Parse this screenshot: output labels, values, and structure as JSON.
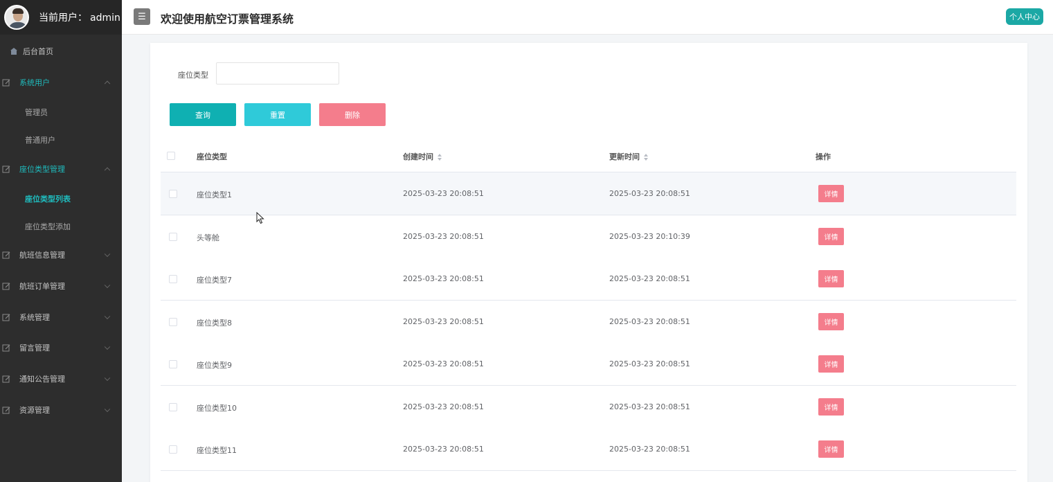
{
  "user": {
    "label": "当前用户：",
    "name": "admin"
  },
  "header": {
    "title": "欢迎使用航空订票管理系统",
    "menu_icon": "☰",
    "personal_center": "个人中心"
  },
  "sidebar": {
    "home": "后台首页",
    "groups": [
      {
        "label": "系统用户",
        "open": true,
        "children": [
          "管理员",
          "普通用户"
        ]
      },
      {
        "label": "座位类型管理",
        "open": true,
        "children": [
          "座位类型列表",
          "座位类型添加"
        ],
        "active_child": "座位类型列表"
      },
      {
        "label": "航班信息管理",
        "open": false
      },
      {
        "label": "航班订单管理",
        "open": false
      },
      {
        "label": "系统管理",
        "open": false
      },
      {
        "label": "留言管理",
        "open": false
      },
      {
        "label": "通知公告管理",
        "open": false
      },
      {
        "label": "资源管理",
        "open": false
      }
    ],
    "accent_color": "#1fbcbe"
  },
  "filter": {
    "label": "座位类型",
    "value": "",
    "placeholder": ""
  },
  "buttons": {
    "query": "查询",
    "reset": "重置",
    "delete": "删除"
  },
  "table": {
    "columns": [
      "座位类型",
      "创建时间",
      "更新时间",
      "操作"
    ],
    "rows": [
      {
        "type": "座位类型1",
        "created": "2025-03-23 20:08:51",
        "updated": "2025-03-23 20:08:51",
        "action": "详情"
      },
      {
        "type": "头等舱",
        "created": "2025-03-23 20:08:51",
        "updated": "2025-03-23 20:10:39",
        "action": "详情"
      },
      {
        "type": "座位类型7",
        "created": "2025-03-23 20:08:51",
        "updated": "2025-03-23 20:08:51",
        "action": "详情"
      },
      {
        "type": "座位类型8",
        "created": "2025-03-23 20:08:51",
        "updated": "2025-03-23 20:08:51",
        "action": "详情"
      },
      {
        "type": "座位类型9",
        "created": "2025-03-23 20:08:51",
        "updated": "2025-03-23 20:08:51",
        "action": "详情"
      },
      {
        "type": "座位类型10",
        "created": "2025-03-23 20:08:51",
        "updated": "2025-03-23 20:08:51",
        "action": "详情"
      },
      {
        "type": "座位类型11",
        "created": "2025-03-23 20:08:51",
        "updated": "2025-03-23 20:08:51",
        "action": "详情"
      }
    ]
  }
}
